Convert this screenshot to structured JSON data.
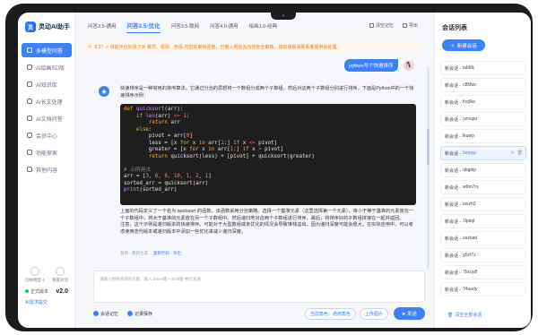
{
  "app": {
    "name": "灵动AI助手",
    "logo_letter": "灵"
  },
  "sidebar": {
    "items": [
      {
        "label": "多模型问答",
        "active": true
      },
      {
        "label": "AI绘画SD版",
        "active": false
      },
      {
        "label": "AI知识库",
        "active": false
      },
      {
        "label": "AI长文处理",
        "active": false
      },
      {
        "label": "AI文档问答",
        "active": false
      },
      {
        "label": "会员中心",
        "active": false
      },
      {
        "label": "功能探索",
        "active": false
      },
      {
        "label": "其他内容",
        "active": false
      }
    ],
    "bottom_buttons": [
      {
        "label": "切换模型-1"
      },
      {
        "label": "重置对话"
      }
    ],
    "version_label": "正式版本",
    "version_value": "v2.0",
    "feedback": "AI需求提交"
  },
  "tabs": [
    {
      "label": "问答3.5-通用",
      "active": false
    },
    {
      "label": "问答3.5-优化",
      "active": true
    },
    {
      "label": "问答3.5-联网",
      "active": false
    },
    {
      "label": "问答4.0-通用",
      "active": false
    },
    {
      "label": "绘画1.0-经典",
      "active": false
    }
  ],
  "top_tools": {
    "clear": "清空记忆",
    "export": "导出"
  },
  "notice": "9.27 -> 目前平台加强了对 暴恐、稳政、色情 内容的审核强度，已接入网信云内容安全审核，如有误报请联系客服申诉处理。",
  "user_message": "python写个快速排序",
  "bot_icon": "bot-icon",
  "answer": {
    "intro": "快速排序是一种常用的排序算法。它通过分治的思想将一个数组分成两个子数组，然后对这两个子数组分别进行排序。下面是Python中的一个快速排序示例：",
    "code": [
      [
        {
          "t": "def ",
          "c": "kw"
        },
        {
          "t": "quicksort",
          "c": "fn"
        },
        {
          "t": "(arr):",
          "c": ""
        }
      ],
      [
        {
          "t": "    if ",
          "c": "kw"
        },
        {
          "t": "len",
          "c": "fn"
        },
        {
          "t": "(arr) ",
          "c": ""
        },
        {
          "t": "<=",
          "c": "op"
        },
        {
          "t": " 1",
          "c": "nm"
        },
        {
          "t": ":",
          "c": ""
        }
      ],
      [
        {
          "t": "        return ",
          "c": "kw"
        },
        {
          "t": "arr",
          "c": ""
        }
      ],
      [
        {
          "t": "    else",
          "c": "kw"
        },
        {
          "t": ":",
          "c": ""
        }
      ],
      [
        {
          "t": "        pivot = arr[",
          "c": ""
        },
        {
          "t": "0",
          "c": "nm"
        },
        {
          "t": "]",
          "c": ""
        }
      ],
      [
        {
          "t": "        less = [x ",
          "c": ""
        },
        {
          "t": "for",
          "c": "kw"
        },
        {
          "t": " x ",
          "c": ""
        },
        {
          "t": "in",
          "c": "kw"
        },
        {
          "t": " arr[",
          "c": ""
        },
        {
          "t": "1",
          "c": "nm"
        },
        {
          "t": ":] ",
          "c": ""
        },
        {
          "t": "if",
          "c": "kw"
        },
        {
          "t": " x ",
          "c": ""
        },
        {
          "t": "<=",
          "c": "op"
        },
        {
          "t": " pivot]",
          "c": ""
        }
      ],
      [
        {
          "t": "        greater = [x ",
          "c": ""
        },
        {
          "t": "for",
          "c": "kw"
        },
        {
          "t": " x ",
          "c": ""
        },
        {
          "t": "in",
          "c": "kw"
        },
        {
          "t": " arr[",
          "c": ""
        },
        {
          "t": "1",
          "c": "nm"
        },
        {
          "t": ":] ",
          "c": ""
        },
        {
          "t": "if",
          "c": "kw"
        },
        {
          "t": " x ",
          "c": ""
        },
        {
          "t": ">",
          "c": "op"
        },
        {
          "t": " pivot]",
          "c": ""
        }
      ],
      [
        {
          "t": "        return ",
          "c": "kw"
        },
        {
          "t": "quicksort(less) + [pivot] + quicksort(greater)",
          "c": ""
        }
      ],
      [
        {
          "t": "",
          "c": ""
        }
      ],
      [
        {
          "t": "# 示例用法",
          "c": "cm"
        }
      ],
      [
        {
          "t": "arr = [",
          "c": ""
        },
        {
          "t": "3, 6, 8, 10, 1, 2, 1",
          "c": "nm"
        },
        {
          "t": "]",
          "c": ""
        }
      ],
      [
        {
          "t": "sorted_arr = quicksort(arr)",
          "c": ""
        }
      ],
      [
        {
          "t": "print",
          "c": "fn"
        },
        {
          "t": "(sorted_arr)",
          "c": ""
        }
      ]
    ],
    "explain": "上面的代码定义了一个名为 quicksort 的函数。该函数采用分治策略。选择一个基准元素（这里选择第一个元素），将小于等于基准的元素放在一个子数组中，将大于基准的元素放在另一个子数组中。然后递归地对这两个子数组进行排序，最后，将排序好的子数组拼接在一起并返回。",
    "note": "注意，这个示例是递归版本的快速排序。可能对于大型数组或未优化的情况会导致堆栈溢出。因为递归深度可能会很大。在实际应用中，可以考虑使用迭代版本或递归版本中添加一些优化来减少递归深度。"
  },
  "hint_line": {
    "left": "复制 · 重新生成",
    "right": "复制代码 · 导出"
  },
  "input": {
    "placeholder": "请输入想要咨询的内容，输入 Enter键 + Shift键 换行发送"
  },
  "bottom": {
    "memory": "会话记忆",
    "save": "记录保存",
    "role": "当前角色：通用角色",
    "upload": "上传图片",
    "send": "发送"
  },
  "right": {
    "title": "会话列表",
    "new_chat": "新建会话",
    "conversations": [
      {
        "prefix": "新会话 -",
        "id": "lab6fc",
        "active": false
      },
      {
        "prefix": "新会话 -",
        "id": "c85fwc",
        "active": false
      },
      {
        "prefix": "新会话 -",
        "id": "fvq9kc",
        "active": false
      },
      {
        "prefix": "新会话 -",
        "id": "yzoupu",
        "active": false
      },
      {
        "prefix": "新会话 -",
        "id": "lkuwp",
        "active": false
      },
      {
        "prefix": "新会话 -",
        "id": "bxrpyp",
        "active": true
      },
      {
        "prefix": "新会话 -",
        "id": "qlqpbp",
        "active": false
      },
      {
        "prefix": "新会话 -",
        "id": "w9m7rx",
        "active": false
      },
      {
        "prefix": "新会话 -",
        "id": "iaxzh3",
        "active": false
      },
      {
        "prefix": "新会话 -",
        "id": "7ipsql",
        "active": false
      },
      {
        "prefix": "新会话 -",
        "id": "xazbad",
        "active": false
      },
      {
        "prefix": "新会话 -",
        "id": "g5cf7z",
        "active": false
      },
      {
        "prefix": "新会话 -",
        "id": "7bcuy8",
        "active": false
      },
      {
        "prefix": "新会话 -",
        "id": "74uudy",
        "active": false
      }
    ],
    "clear_all": "清空全部会话"
  },
  "colors": {
    "accent": "#3b82f6",
    "notice_text": "#e87b1c",
    "code_bg": "#1e1e1e"
  }
}
